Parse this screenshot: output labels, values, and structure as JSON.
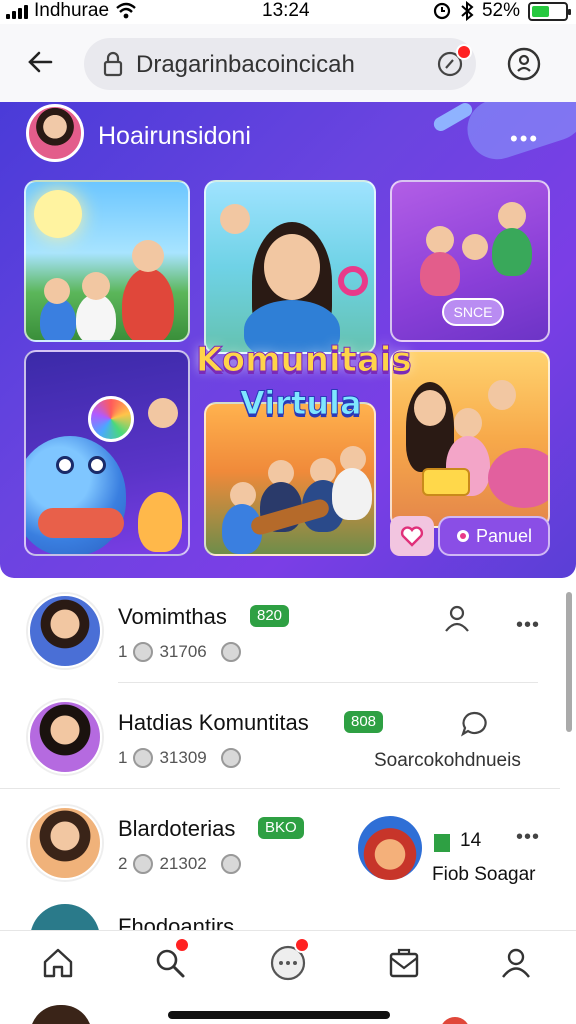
{
  "status_bar": {
    "carrier": "Indhurae",
    "time": "13:24",
    "battery": "52%",
    "battery_level": 0.52,
    "icons": [
      "signal-icon",
      "wifi-icon",
      "alarm-icon",
      "bluetooth-icon",
      "battery-icon"
    ]
  },
  "browser": {
    "url": "Dragarinbacoincicah",
    "icons": [
      "back-arrow-icon",
      "lock-icon",
      "sync-icon",
      "account-icon"
    ]
  },
  "hero": {
    "title": "Hoairunsidoni",
    "overlay_line1": "Komunitais",
    "overlay_line2": "Virtula",
    "tile_pill": "SNCE",
    "panel_button": "Panuel",
    "more": "•••"
  },
  "list": [
    {
      "name": "Vomimthas",
      "badge": "820",
      "count": "1",
      "stat": "31706",
      "side_text": ""
    },
    {
      "name": "Hatdias Komuntitas",
      "badge": "808",
      "count": "1",
      "stat": "31309",
      "side_text": "Soarcokohdnueis"
    },
    {
      "name": "Blardoterias",
      "badge": "BKO",
      "count": "2",
      "stat": "21302",
      "extra_code": "14",
      "side_text": "Fiob Soagar"
    }
  ],
  "clipped_row": {
    "text": "Fhodoantirs"
  },
  "bottom_nav": [
    "home-icon",
    "search-icon",
    "chat-icon",
    "inbox-icon",
    "profile-icon"
  ],
  "colors": {
    "accent_purple": "#6a44e0",
    "badge_green": "#2ea043",
    "notif_red": "#ff2222"
  }
}
